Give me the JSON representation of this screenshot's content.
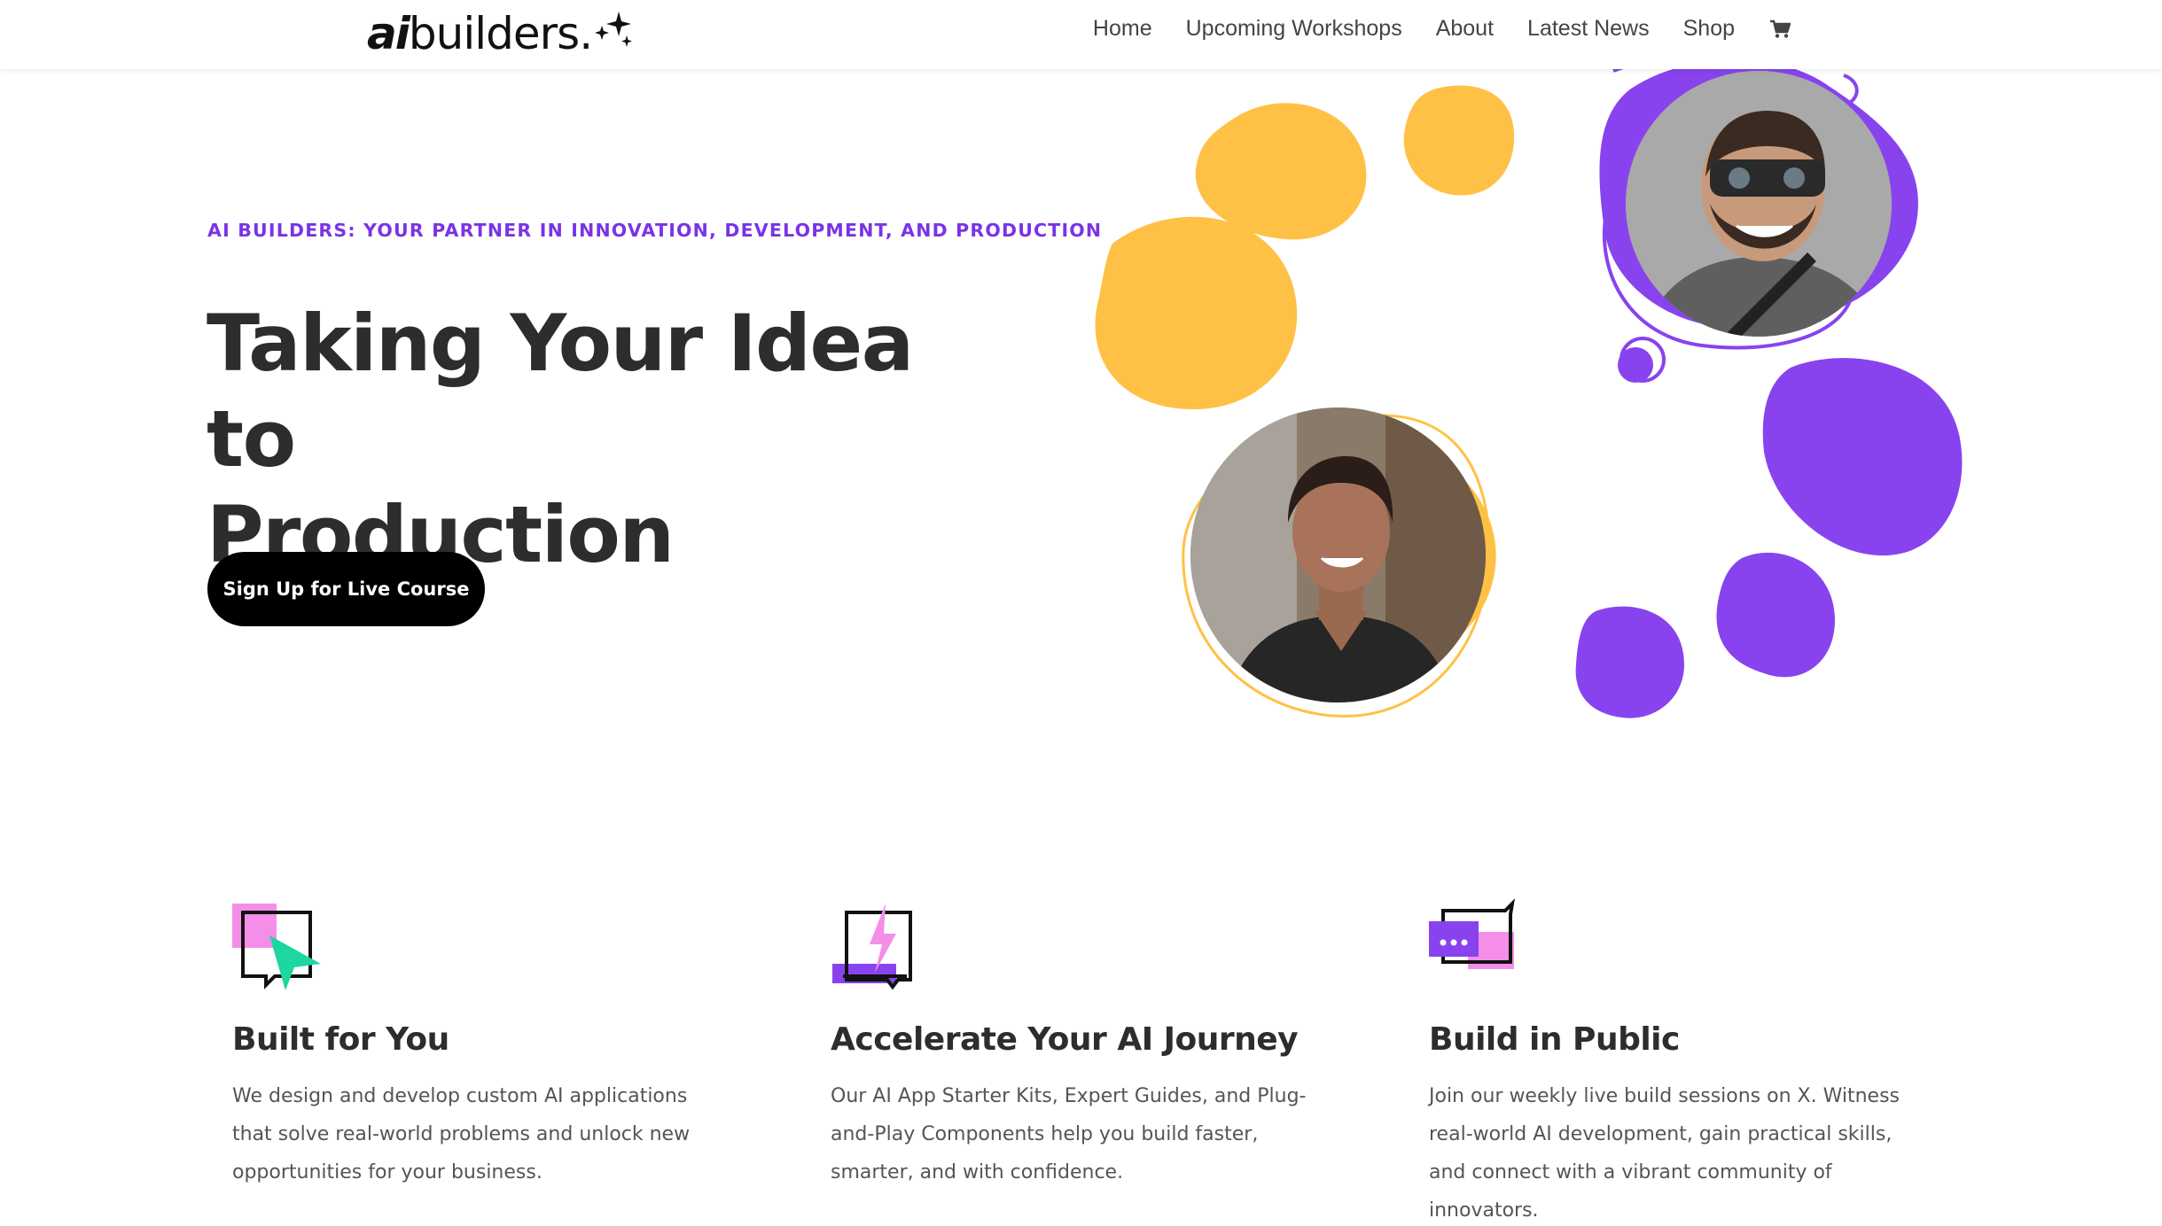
{
  "header": {
    "logo": {
      "ai": "ai",
      "rest": "builders."
    },
    "nav": [
      "Home",
      "Upcoming Workshops",
      "About",
      "Latest News",
      "Shop"
    ],
    "cart_icon": "cart-icon"
  },
  "hero": {
    "eyebrow": "AI BUILDERS: YOUR PARTNER IN INNOVATION, DEVELOPMENT, AND PRODUCTION",
    "title_line1": "Taking Your Idea to",
    "title_line2": "Production",
    "cta_label": "Sign Up for Live Course"
  },
  "colors": {
    "accent": "#7a33e8",
    "yellow": "#ffc145",
    "purple": "#8843ee",
    "pink": "#f58ee8",
    "teal": "#1dd6a0"
  },
  "features": [
    {
      "icon": "chat-cursor-icon",
      "title": "Built for You",
      "text": "We design and develop custom AI applications that solve real-world problems and unlock new opportunities for your business."
    },
    {
      "icon": "lightning-chat-icon",
      "title": "Accelerate Your AI Journey",
      "text": "Our AI App Starter Kits, Expert Guides, and Plug-and-Play Components help you build faster, smarter, and with confidence."
    },
    {
      "icon": "chat-dots-icon",
      "title": "Build in Public",
      "text": "Join our weekly live build sessions on X. Witness real-world AI development, gain practical skills, and connect with a vibrant community of innovators."
    }
  ]
}
